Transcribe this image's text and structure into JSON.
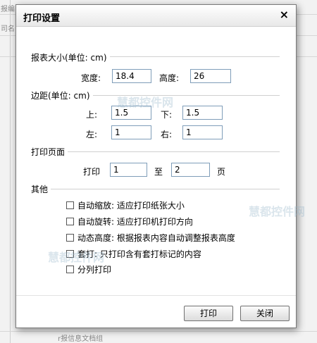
{
  "background": {
    "frag1": "报编",
    "frag2": "司名",
    "frag3": "r报信息文档组"
  },
  "dialog": {
    "title": "打印设置",
    "close_glyph": "×"
  },
  "paper_size": {
    "heading": "报表大小(单位: cm)",
    "width_label": "宽度:",
    "width_value": "18.4",
    "height_label": "高度:",
    "height_value": "26"
  },
  "margins": {
    "heading": "边距(单位: cm)",
    "top_label": "上:",
    "top_value": "1.5",
    "bottom_label": "下:",
    "bottom_value": "1.5",
    "left_label": "左:",
    "left_value": "1",
    "right_label": "右:",
    "right_value": "1"
  },
  "pages": {
    "heading": "打印页面",
    "print_label": "打印",
    "from_value": "1",
    "to_label": "至",
    "to_value": "2",
    "page_label": "页"
  },
  "other": {
    "heading": "其他",
    "options": [
      {
        "label": "自动缩放: 适应打印纸张大小",
        "checked": false
      },
      {
        "label": "自动旋转: 适应打印机打印方向",
        "checked": false
      },
      {
        "label": "动态高度: 根据报表内容自动调整报表高度",
        "checked": false
      },
      {
        "label": "套打: 只打印含有套打标记的内容",
        "checked": false
      },
      {
        "label": "分列打印",
        "checked": false
      }
    ]
  },
  "buttons": {
    "print": "打印",
    "close": "关闭"
  },
  "watermark": {
    "text1": "慧都控件网",
    "text2": "慧都控件网",
    "text3": "慧都控件网"
  }
}
